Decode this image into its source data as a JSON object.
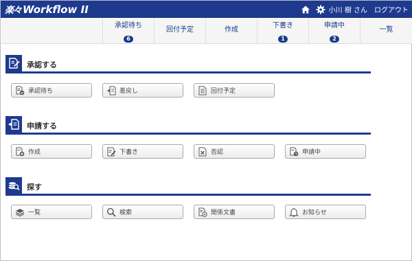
{
  "header": {
    "logo_mark": "楽々",
    "logo_text": "Workflow II",
    "user_name": "小川 樹 さん",
    "logout_label": "ログアウト"
  },
  "nav": {
    "tabs": [
      {
        "label": "承認待ち",
        "badge": "6"
      },
      {
        "label": "回付予定",
        "badge": ""
      },
      {
        "label": "作成",
        "badge": ""
      },
      {
        "label": "下書き",
        "badge": "1"
      },
      {
        "label": "申請中",
        "badge": "2"
      },
      {
        "label": "一覧",
        "badge": ""
      }
    ]
  },
  "sections": {
    "approve": {
      "title": "承認する",
      "buttons": [
        "承認待ち",
        "差戻し",
        "回付予定"
      ]
    },
    "apply": {
      "title": "申請する",
      "buttons": [
        "作成",
        "下書き",
        "否認",
        "申請中"
      ]
    },
    "search": {
      "title": "探す",
      "buttons": [
        "一覧",
        "検索",
        "関係文書",
        "お知らせ"
      ]
    }
  },
  "colors": {
    "brand": "#1e3a8f",
    "nav_text": "#1a3a8c"
  }
}
